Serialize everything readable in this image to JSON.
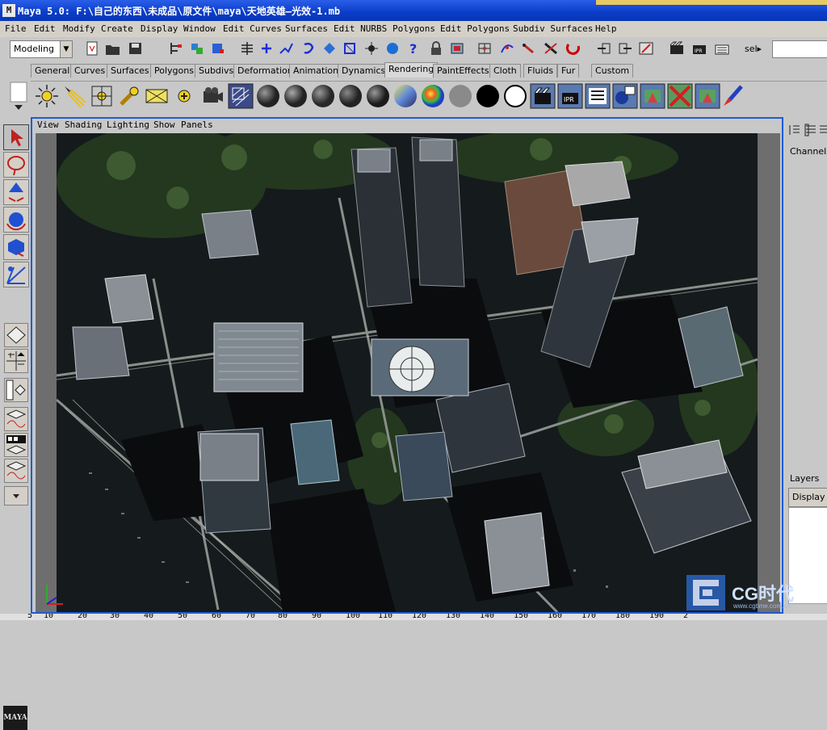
{
  "window": {
    "title": "Maya 5.0: F:\\自己的东西\\未成品\\原文件\\maya\\天地英雄—光效-1.mb",
    "logo_letter": "M"
  },
  "menubar": [
    "File",
    "Edit",
    "Modify",
    "Create",
    "Display",
    "Window",
    "Edit Curves",
    "Surfaces",
    "Edit NURBS",
    "Polygons",
    "Edit Polygons",
    "Subdiv Surfaces",
    "Help"
  ],
  "statusline": {
    "mode": "Modeling",
    "sel_label": "sel▸"
  },
  "shelf_tabs": [
    "General",
    "Curves",
    "Surfaces",
    "Polygons",
    "Subdivs",
    "Deformation",
    "Animation",
    "Dynamics",
    "Rendering",
    "PaintEffects",
    "Cloth",
    "Fluids",
    "Fur",
    "Custom"
  ],
  "shelf_active_tab": "Rendering",
  "shelf_icons": [
    "point-light-icon",
    "spot-light-icon",
    "directional-light-icon",
    "area-light-icon",
    "volume-light-icon",
    "ambient-light-icon",
    "camera-icon",
    "camera-aim-icon",
    "lambert-sphere-icon",
    "blinn-sphere-icon",
    "phong-sphere-icon",
    "phonge-sphere-icon",
    "anisotropic-sphere-icon",
    "layered-shader-icon",
    "ramp-shader-icon",
    "surface-shader-icon",
    "black-shader-icon",
    "use-background-icon",
    "render-icon",
    "ipr-render-icon",
    "render-settings-icon",
    "hypershade-icon",
    "batch-render-icon",
    "hardware-render-icon",
    "paint-render-icon",
    "paint-canvas-icon"
  ],
  "panel_menu": [
    "View",
    "Shading",
    "Lighting",
    "Show",
    "Panels"
  ],
  "right_panel": {
    "channels_label": "Channels",
    "layers_label": "Layers",
    "display_label": "Display"
  },
  "ruler_ticks": [
    "5",
    "10",
    "20",
    "30",
    "40",
    "50",
    "60",
    "70",
    "80",
    "90",
    "100",
    "110",
    "120",
    "130",
    "140",
    "150",
    "160",
    "170",
    "180",
    "190",
    "2"
  ],
  "watermark": {
    "main": "CG时代",
    "sub": "www.cgtime.com.cn"
  },
  "maya_logo": "MAYA",
  "colors": {
    "title_blue": "#0a3cc8",
    "panel_border": "#1e5cd8",
    "ui_gray": "#c8c8c8"
  }
}
